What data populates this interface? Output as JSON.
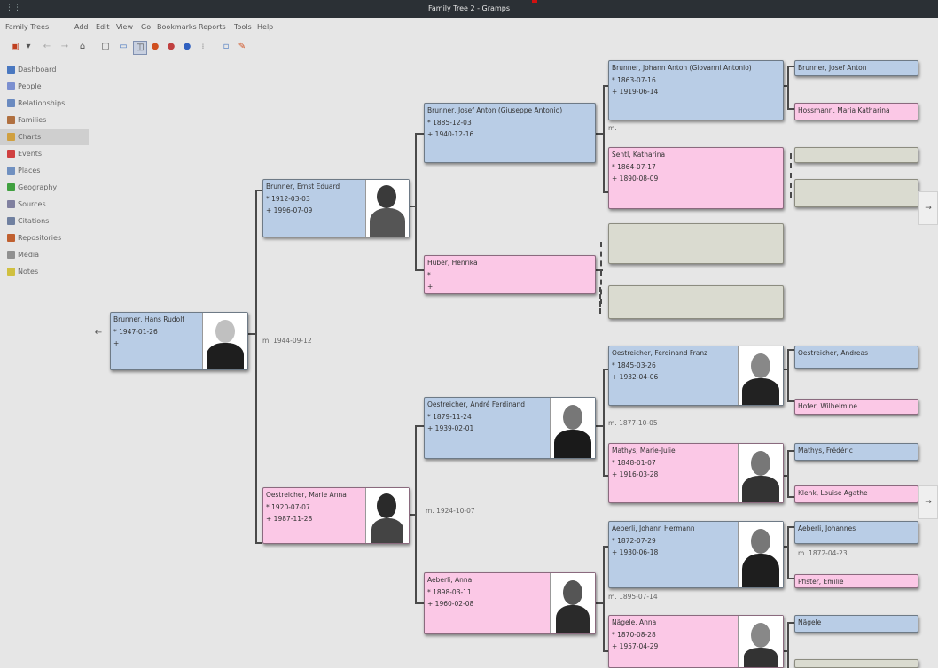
{
  "window": {
    "title": "Family Tree 2 - Gramps"
  },
  "menu": [
    "Family Trees",
    "Add",
    "Edit",
    "View",
    "Go",
    "Bookmarks",
    "Reports",
    "Tools",
    "Help"
  ],
  "sidebar": [
    {
      "label": "Dashboard",
      "icon": "dashboard-icon",
      "color": "#4a78c0"
    },
    {
      "label": "People",
      "icon": "people-icon",
      "color": "#7b8fd0"
    },
    {
      "label": "Relationships",
      "icon": "relationships-icon",
      "color": "#6a8ac0"
    },
    {
      "label": "Families",
      "icon": "families-icon",
      "color": "#b07040"
    },
    {
      "label": "Charts",
      "icon": "charts-icon",
      "color": "#d0a040",
      "active": true
    },
    {
      "label": "Events",
      "icon": "events-icon",
      "color": "#d04040"
    },
    {
      "label": "Places",
      "icon": "places-icon",
      "color": "#7090c0"
    },
    {
      "label": "Geography",
      "icon": "geography-icon",
      "color": "#40a040"
    },
    {
      "label": "Sources",
      "icon": "sources-icon",
      "color": "#8080a0"
    },
    {
      "label": "Citations",
      "icon": "citations-icon",
      "color": "#7080a0"
    },
    {
      "label": "Repositories",
      "icon": "repositories-icon",
      "color": "#c06030"
    },
    {
      "label": "Media",
      "icon": "media-icon",
      "color": "#909090"
    },
    {
      "label": "Notes",
      "icon": "notes-icon",
      "color": "#d0c040"
    }
  ],
  "people": {
    "root": {
      "name": "Brunner, Hans Rudolf",
      "birth": "* 1947-01-26",
      "death": "+"
    },
    "p1": {
      "name": "Brunner, Ernst Eduard",
      "birth": "* 1912-03-03",
      "death": "+ 1996-07-09"
    },
    "p2": {
      "name": "Oestreicher, Marie Anna",
      "birth": "* 1920-07-07",
      "death": "+ 1987-11-28"
    },
    "g1": {
      "name": "Brunner, Josef Anton (Giuseppe Antonio)",
      "birth": "* 1885-12-03",
      "death": "+ 1940-12-16"
    },
    "g2": {
      "name": "Huber, Henrika",
      "birth": "*",
      "death": "+"
    },
    "g3": {
      "name": "Oestreicher, André Ferdinand",
      "birth": "* 1879-11-24",
      "death": "+ 1939-02-01"
    },
    "g4": {
      "name": "Aeberli, Anna",
      "birth": "* 1898-03-11",
      "death": "+ 1960-02-08"
    },
    "gg1": {
      "name": "Brunner, Johann Anton (Giovanni Antonio)",
      "birth": "* 1863-07-16",
      "death": "+ 1919-06-14"
    },
    "gg2": {
      "name": "Sentl, Katharina",
      "birth": "* 1864-07-17",
      "death": "+ 1890-08-09"
    },
    "gg5": {
      "name": "Oestreicher, Ferdinand Franz",
      "birth": "* 1845-03-26",
      "death": "+ 1932-04-06"
    },
    "gg6": {
      "name": "Mathys, Marie-Julie",
      "birth": "* 1848-01-07",
      "death": "+ 1916-03-28"
    },
    "gg7": {
      "name": "Aeberli, Johann Hermann",
      "birth": "* 1872-07-29",
      "death": "+ 1930-06-18"
    },
    "gg8": {
      "name": "Nägele, Anna",
      "birth": "* 1870-08-28",
      "death": "+ 1957-04-29"
    },
    "ggg1": {
      "name": "Brunner, Josef Anton"
    },
    "ggg2": {
      "name": "Hossmann, Maria Katharina"
    },
    "ggg9": {
      "name": "Oestreicher, Andreas"
    },
    "ggg10": {
      "name": "Hofer, Wilhelmine"
    },
    "ggg11": {
      "name": "Mathys, Frédéric"
    },
    "ggg12": {
      "name": "Klenk, Louise Agathe"
    },
    "ggg13": {
      "name": "Aeberli, Johannes"
    },
    "ggg14": {
      "name": "Pfister, Emilie"
    },
    "ggg15": {
      "name": "Nägele"
    }
  },
  "marriages": {
    "root": "m. 1944-09-12",
    "p1": "m.",
    "p2": "m. 1924-10-07",
    "g3": "m. 1877-10-05",
    "g4": "m. 1895-07-14",
    "gg7": "m. 1872-04-23"
  }
}
